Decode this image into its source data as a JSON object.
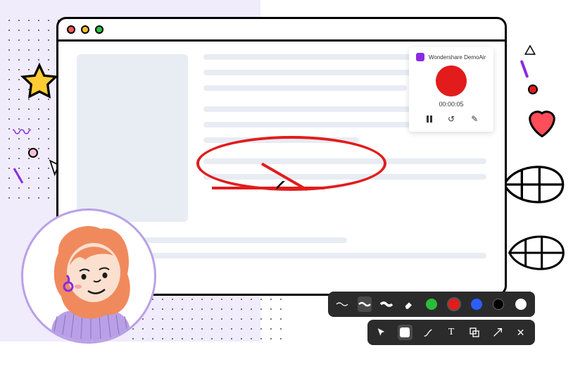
{
  "recorder": {
    "brand_label": "Wondershare DemoAir",
    "time": "00:00:05",
    "controls": {
      "pause": "pause",
      "restart": "restart",
      "edit": "edit"
    }
  },
  "colors": {
    "accent_red": "#e21c1c",
    "accent_purple": "#8a2be2",
    "toolbar_bg": "#2b2b2b",
    "lilac_bg": "#f0ecfb",
    "placeholder": "#e8ecf3",
    "green": "#2bbd3a",
    "blue": "#2a5fff",
    "black": "#000000",
    "white": "#ffffff"
  },
  "draw_toolbar": {
    "strokes": [
      "thin-line",
      "medium-line",
      "thick-line"
    ],
    "eraser_label": "eraser",
    "palette": [
      "green",
      "red",
      "blue",
      "black",
      "white"
    ],
    "selected_stroke": 1,
    "selected_color": 1
  },
  "tool_toolbar": {
    "tools": [
      "pointer",
      "marker",
      "brush",
      "text",
      "shape",
      "arrow",
      "close"
    ],
    "selected": 1
  },
  "icons": {
    "star": "star",
    "heart": "heart",
    "triangle": "triangle",
    "cursor": "cursor",
    "leaf": "leaf"
  }
}
